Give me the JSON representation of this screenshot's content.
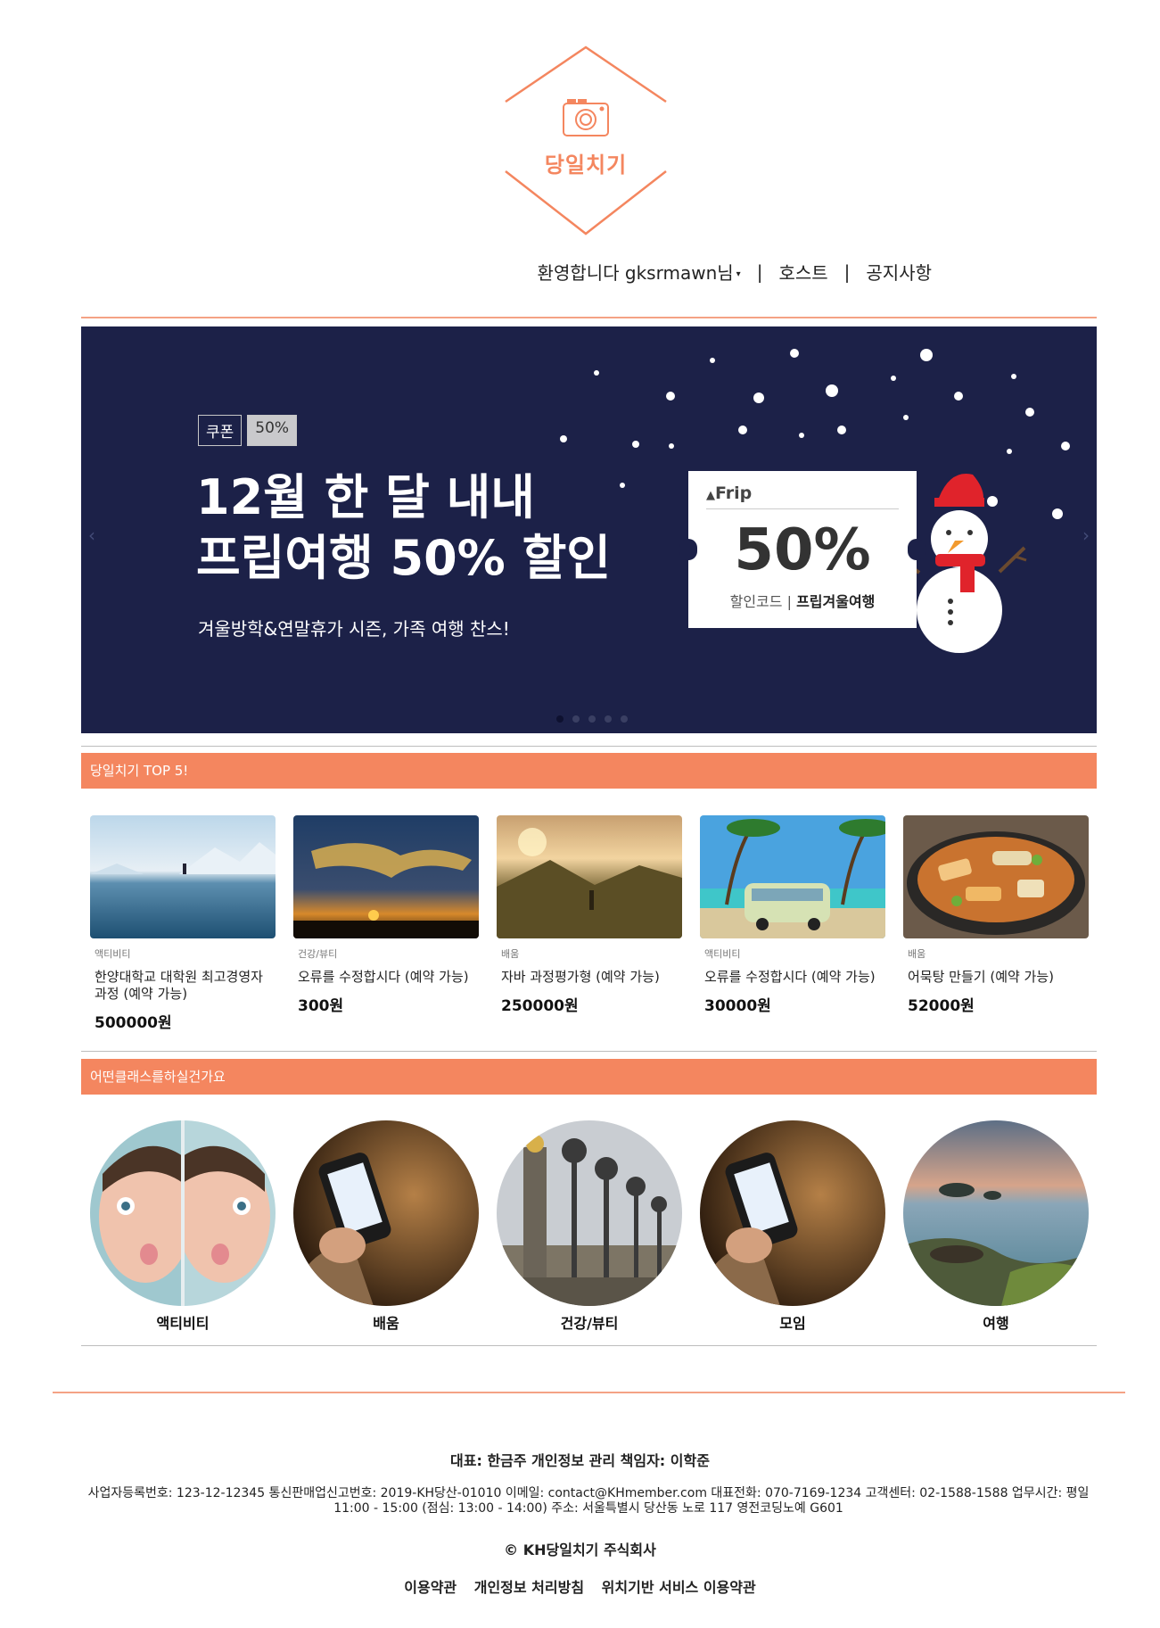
{
  "brand": {
    "logo_text": "당일치기",
    "accent_color": "#f4865f"
  },
  "topnav": {
    "welcome": "환영합니다 gksrmawn님",
    "host": "호스트",
    "notice": "공지사항",
    "separator": "|"
  },
  "banner": {
    "tag_label": "쿠폰",
    "tag_value": "50%",
    "headline_1": "12월 한 달 내내",
    "headline_2": "프립여행 50% 할인",
    "subline": "겨울방학&연말휴가 시즌, 가족 여행 찬스!",
    "ticket_brand": "Frip",
    "ticket_value": "50%",
    "ticket_code_label": "할인코드 | ",
    "ticket_code": "프립겨울여행",
    "slide_count": 5,
    "active_slide": 1,
    "background_color": "#1c2148"
  },
  "top5": {
    "section_title": "당일치기 TOP 5!",
    "items": [
      {
        "category": "액티비티",
        "title": "한양대학교 대학원 최고경영자 과정 (예약 가능)",
        "price": "500000원",
        "image": "frozen-lake-photo"
      },
      {
        "category": "건강/뷰티",
        "title": "오류를 수정합시다 (예약 가능)",
        "price": "300원",
        "image": "sunset-clouds-photo"
      },
      {
        "category": "배움",
        "title": "자바 과정평가형 (예약 가능)",
        "price": "250000원",
        "image": "mountain-sunrise-photo"
      },
      {
        "category": "액티비티",
        "title": "오류를 수정합시다 (예약 가능)",
        "price": "30000원",
        "image": "beach-van-photo"
      },
      {
        "category": "배움",
        "title": "어묵탕 만들기 (예약 가능)",
        "price": "52000원",
        "image": "fishcake-soup-photo"
      }
    ]
  },
  "categories": {
    "section_title": "어떤클래스를하실건가요",
    "items": [
      {
        "label": "액티비티",
        "image": "face-mirror-photo"
      },
      {
        "label": "배움",
        "image": "smartphone-hand-photo"
      },
      {
        "label": "건강/뷰티",
        "image": "bridge-lamps-photo"
      },
      {
        "label": "모임",
        "image": "smartphone-hand-photo"
      },
      {
        "label": "여행",
        "image": "coastline-photo"
      }
    ]
  },
  "footer": {
    "line1": "대표: 한금주 개인정보 관리 책임자: 이학준",
    "line2": "사업자등록번호: 123-12-12345 통신판매업신고번호: 2019-KH당산-01010 이메일: contact@KHmember.com 대표전화: 070-7169-1234 고객센터: 02-1588-1588 업무시간: 평일 11:00 - 15:00 (점심: 13:00 - 14:00) 주소: 서울특별시 당산동 노로 117 영전코딩노예 G601",
    "copyright": "© KH당일치기 주식회사",
    "links": [
      "이용약관",
      "개인정보 처리방침",
      "위치기반 서비스 이용약관"
    ]
  }
}
